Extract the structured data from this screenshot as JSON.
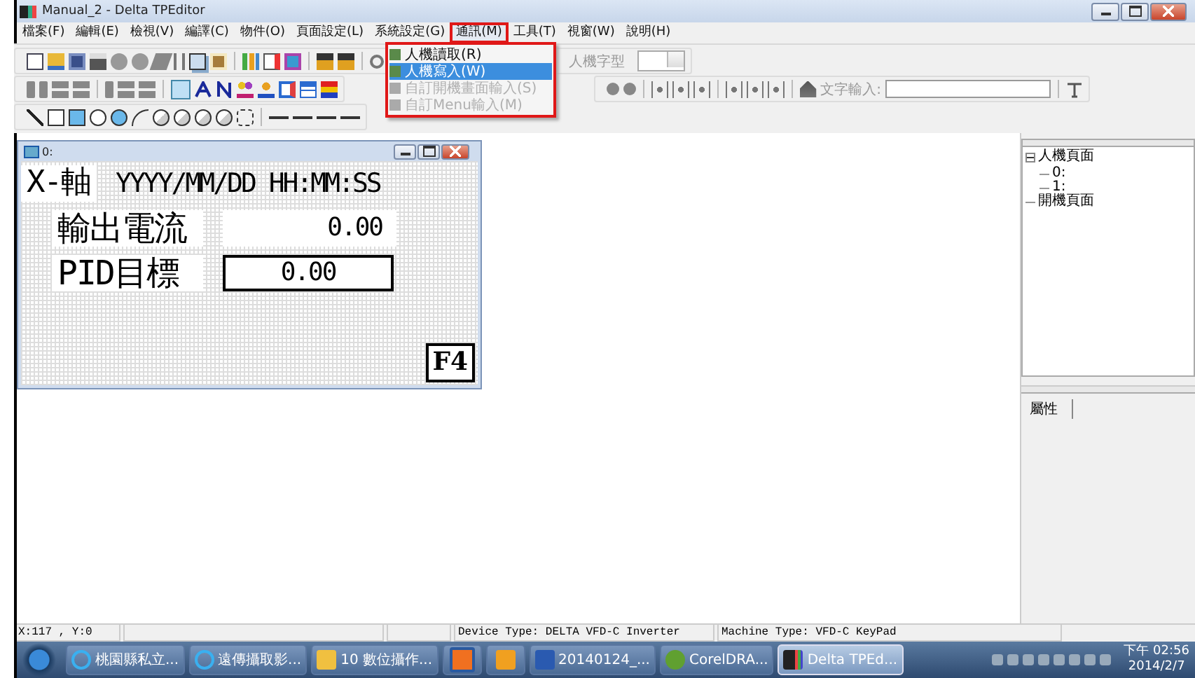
{
  "window": {
    "title": "Manual_2 - Delta TPEditor"
  },
  "menu": [
    {
      "label": "檔案(F)",
      "selected": false
    },
    {
      "label": "編輯(E)",
      "selected": false
    },
    {
      "label": "檢視(V)",
      "selected": false
    },
    {
      "label": "編譯(C)",
      "selected": false
    },
    {
      "label": "物件(O)",
      "selected": false
    },
    {
      "label": "頁面設定(L)",
      "selected": false
    },
    {
      "label": "系統設定(G)",
      "selected": false
    },
    {
      "label": "通訊(M)",
      "selected": true
    },
    {
      "label": "工具(T)",
      "selected": false
    },
    {
      "label": "視窗(W)",
      "selected": false
    },
    {
      "label": "說明(H)",
      "selected": false
    }
  ],
  "dropdown": [
    {
      "label": "人機讀取(R)",
      "selected": false,
      "disabled": false
    },
    {
      "label": "人機寫入(W)",
      "selected": true,
      "disabled": false
    },
    {
      "label": "自訂開機畫面輸入(S)",
      "selected": false,
      "disabled": true
    },
    {
      "label": "自訂Menu輸入(M)",
      "selected": false,
      "disabled": true
    }
  ],
  "font_label": "人機字型",
  "text_input_label": "文字輸入:",
  "screen": {
    "title": "0:",
    "axis_label": "X-軸",
    "datetime": "YYYY/MM/DD HH:MM:SS",
    "rows": [
      {
        "label": "輸出電流",
        "value": "0.00",
        "kind": "display"
      },
      {
        "label": "PID目標",
        "value": "0.00",
        "kind": "input"
      }
    ],
    "key": "F4"
  },
  "tree": [
    {
      "label": "人機頁面",
      "expanded": true,
      "children": [
        {
          "label": "0:"
        },
        {
          "label": "1:"
        }
      ]
    },
    {
      "label": "開機頁面"
    }
  ],
  "properties_tab": "屬性",
  "status_bar": {
    "position": "X:117 , Y:0",
    "device": "Device Type: DELTA VFD-C Inverter",
    "machine": "Machine Type: VFD-C KeyPad"
  },
  "taskbar": [
    {
      "label": "桃園縣私立...",
      "kind": "ie",
      "selected": false
    },
    {
      "label": "遠傳攝取影...",
      "kind": "ie",
      "selected": false
    },
    {
      "label": "10 數位攝作...",
      "kind": "folder",
      "selected": false
    },
    {
      "kind": "media",
      "selected": false
    },
    {
      "kind": "outlook",
      "selected": false
    },
    {
      "label": "20140124_...",
      "kind": "word",
      "selected": false
    },
    {
      "label": "CorelDRA...",
      "kind": "corel",
      "selected": false
    },
    {
      "label": "Delta TPEd...",
      "kind": "app",
      "selected": true
    }
  ],
  "clock": {
    "time": "下午 02:56",
    "date": "2014/2/7"
  }
}
